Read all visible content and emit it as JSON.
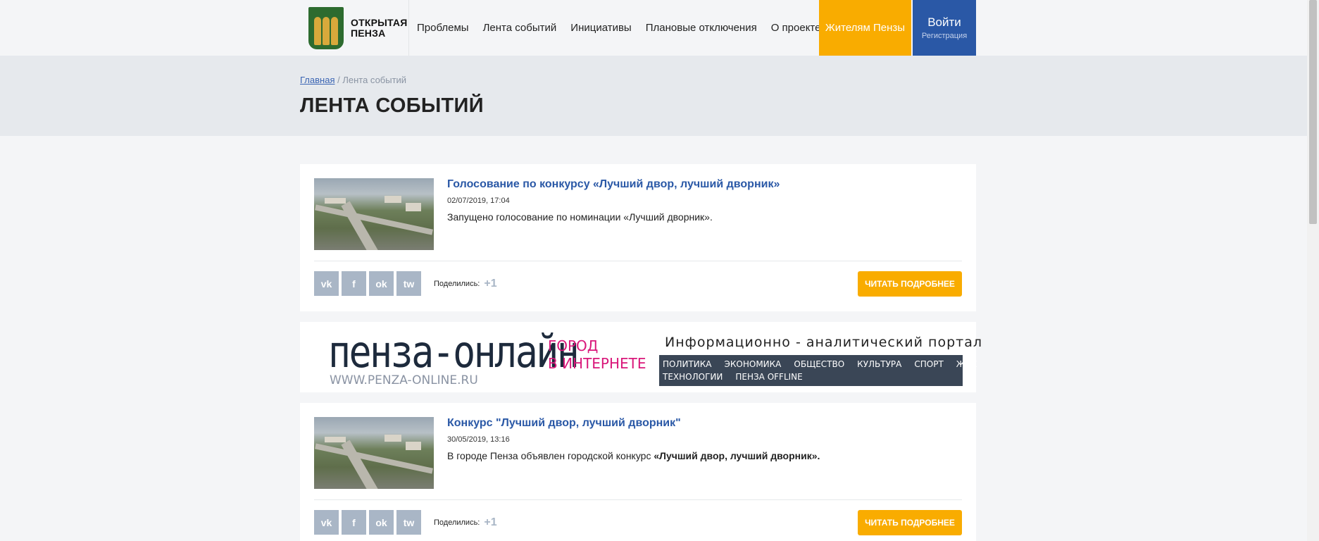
{
  "header": {
    "logo_text": "ОТКРЫТАЯ ПЕНЗА",
    "nav": [
      "Проблемы",
      "Лента событий",
      "Инициативы",
      "Плановые отключения",
      "О проекте"
    ],
    "residents_button": "Жителям Пензы",
    "login_button": "Войти",
    "register_link": "Регистрация"
  },
  "breadcrumb": {
    "home": "Главная",
    "separator": " / ",
    "current": "Лента событий"
  },
  "page_title": "ЛЕНТА СОБЫТИЙ",
  "cards": [
    {
      "title": "Голосование по конкурсу «Лучший двор, лучший дворник»",
      "date": "02/07/2019, 17:04",
      "text": "Запущено голосование по номинации «Лучший дворник».",
      "text_bold": "",
      "share_label": "Поделились:",
      "share_count": "+1",
      "more_button": "ЧИТАТЬ ПОДРОБНЕЕ"
    },
    {
      "title": "Конкурс \"Лучший двор, лучший дворник\"",
      "date": "30/05/2019, 13:16",
      "text": "В городе Пенза объявлен городской конкурс ",
      "text_bold": "«Лучший двор, лучший дворник».",
      "share_label": "Поделились:",
      "share_count": "+1",
      "more_button": "ЧИТАТЬ ПОДРОБНЕЕ"
    }
  ],
  "share_icons": [
    "vk-icon",
    "facebook-icon",
    "odnoklassniki-icon",
    "twitter-icon"
  ],
  "share_glyphs": [
    "vk",
    "f",
    "ok",
    "tw"
  ],
  "banner": {
    "logo": "пенза-онлайн",
    "slogan_1": "ГОРОД",
    "slogan_2": "В ИНТЕРНЕТЕ",
    "url": "WWW.PENZA-ONLINE.RU",
    "portal": "Информационно - аналитический портал",
    "menu": [
      "ПОЛИТИКА",
      "ЭКОНОМИКА",
      "ОБЩЕСТВО",
      "КУЛЬТУРА",
      "СПОРТ",
      "ЖКХ",
      "ТЕХНОЛОГИИ",
      "ПЕНЗА OFFLINE"
    ]
  },
  "colors": {
    "accent_yellow": "#f9ac00",
    "accent_blue": "#2a58a6",
    "share_grey": "#a9b6c6"
  }
}
